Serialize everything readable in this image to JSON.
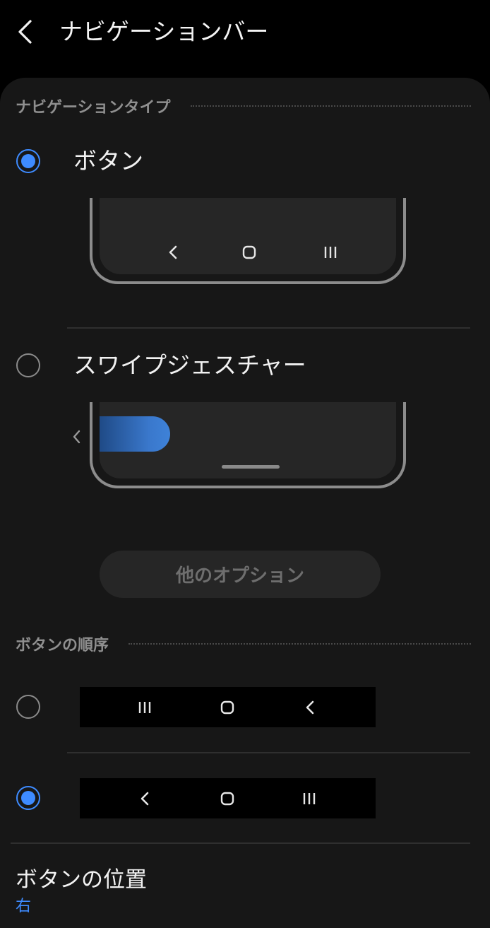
{
  "app": {
    "title": "ナビゲーションバー"
  },
  "sections": {
    "nav_type": {
      "header": "ナビゲーションタイプ",
      "options": [
        {
          "label": "ボタン",
          "checked": true
        },
        {
          "label": "スワイプジェスチャー",
          "checked": false
        }
      ],
      "more_options_label": "他のオプション"
    },
    "button_order": {
      "header": "ボタンの順序",
      "options": [
        {
          "icons": [
            "recents-icon",
            "home-icon",
            "back-icon"
          ],
          "checked": false
        },
        {
          "icons": [
            "back-icon",
            "home-icon",
            "recents-icon"
          ],
          "checked": true
        }
      ]
    },
    "button_position": {
      "title": "ボタンの位置",
      "value": "右"
    }
  },
  "colors": {
    "accent": "#3e8bff",
    "background": "#171717",
    "appbar": "#000000",
    "muted_text": "#8f8f8f"
  }
}
